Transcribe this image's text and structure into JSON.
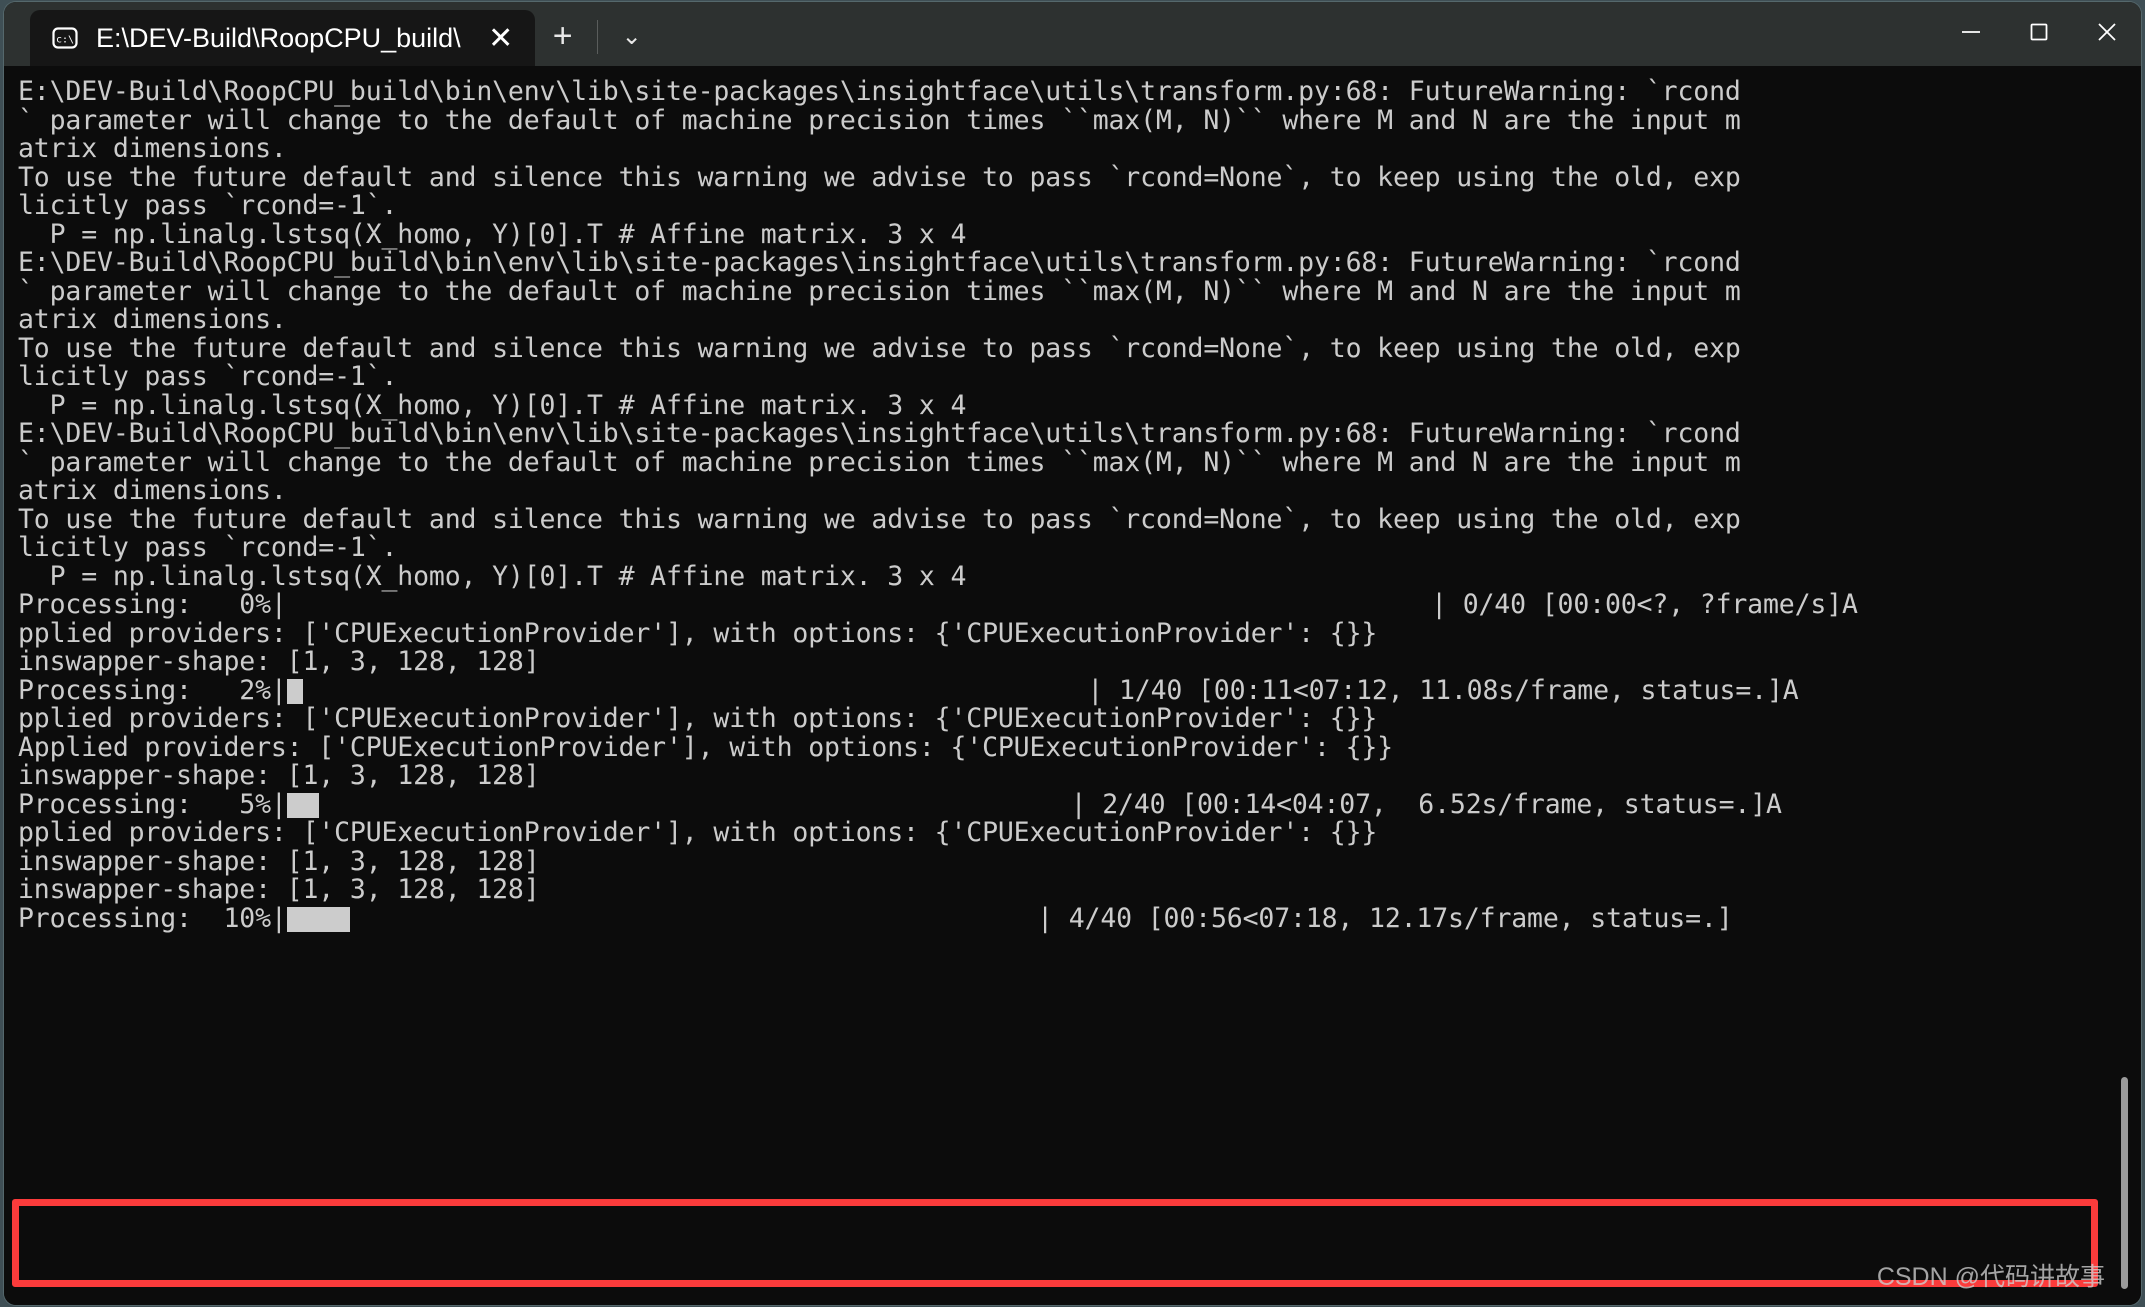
{
  "window": {
    "titlebar_color": "#2d3130",
    "terminal_bg": "#0c0c0c",
    "terminal_fg": "#cccccc",
    "tab": {
      "icon": "cmd-prompt-icon",
      "icon_label": "c:\\",
      "title": "E:\\DEV-Build\\RoopCPU_build\\",
      "close_label": "✕"
    },
    "new_tab_label": "+",
    "dropdown_label": "⌄",
    "controls": {
      "minimize": "minimize-icon",
      "maximize": "maximize-icon",
      "close": "close-icon"
    }
  },
  "annotation": {
    "box_color": "#fb3b3b",
    "watermark": "CSDN @代码讲故事"
  },
  "terminal": {
    "lines": [
      "E:\\DEV-Build\\RoopCPU_build\\bin\\env\\lib\\site-packages\\insightface\\utils\\transform.py:68: FutureWarning: `rcond",
      "` parameter will change to the default of machine precision times ``max(M, N)`` where M and N are the input m",
      "atrix dimensions.",
      "To use the future default and silence this warning we advise to pass `rcond=None`, to keep using the old, exp",
      "licitly pass `rcond=-1`.",
      "  P = np.linalg.lstsq(X_homo, Y)[0].T # Affine matrix. 3 x 4",
      "E:\\DEV-Build\\RoopCPU_build\\bin\\env\\lib\\site-packages\\insightface\\utils\\transform.py:68: FutureWarning: `rcond",
      "` parameter will change to the default of machine precision times ``max(M, N)`` where M and N are the input m",
      "atrix dimensions.",
      "To use the future default and silence this warning we advise to pass `rcond=None`, to keep using the old, exp",
      "licitly pass `rcond=-1`.",
      "  P = np.linalg.lstsq(X_homo, Y)[0].T # Affine matrix. 3 x 4",
      "E:\\DEV-Build\\RoopCPU_build\\bin\\env\\lib\\site-packages\\insightface\\utils\\transform.py:68: FutureWarning: `rcond",
      "` parameter will change to the default of machine precision times ``max(M, N)`` where M and N are the input m",
      "atrix dimensions.",
      "To use the future default and silence this warning we advise to pass `rcond=None`, to keep using the old, exp",
      "licitly pass `rcond=-1`.",
      "  P = np.linalg.lstsq(X_homo, Y)[0].T # Affine matrix. 3 x 4"
    ],
    "progress_rows": [
      {
        "label": "Processing:",
        "percent": "  0%",
        "bar_blocks": 0,
        "suffix": "| 0/40 [00:00<?, ?frame/s]A",
        "gap_chars": 35
      },
      {
        "label": "Processing:",
        "percent": "  2%",
        "bar_blocks": 1,
        "suffix": "| 1/40 [00:11<07:12, 11.08s/frame, status=.]A",
        "gap_chars": 24
      },
      {
        "label": "Processing:",
        "percent": "  5%",
        "bar_blocks": 2,
        "suffix": "| 2/40 [00:14<04:07,  6.52s/frame, status=.]A",
        "gap_chars": 23
      },
      {
        "label": "Processing:",
        "percent": " 10%",
        "bar_blocks": 4,
        "suffix": "| 4/40 [00:56<07:18, 12.17s/frame, status=.]",
        "gap_chars": 21
      }
    ],
    "provider_line": "pplied providers: ['CPUExecutionProvider'], with options: {'CPUExecutionProvider': {}}",
    "provider_line_full": "Applied providers: ['CPUExecutionProvider'], with options: {'CPUExecutionProvider': {}}",
    "shape_line": "inswapper-shape: [1, 3, 128, 128]",
    "tail_sequence": [
      "p0",
      "provider",
      "shape",
      "p1",
      "provider",
      "provider_full",
      "shape",
      "p2",
      "provider",
      "shape",
      "shape",
      "p3"
    ]
  }
}
